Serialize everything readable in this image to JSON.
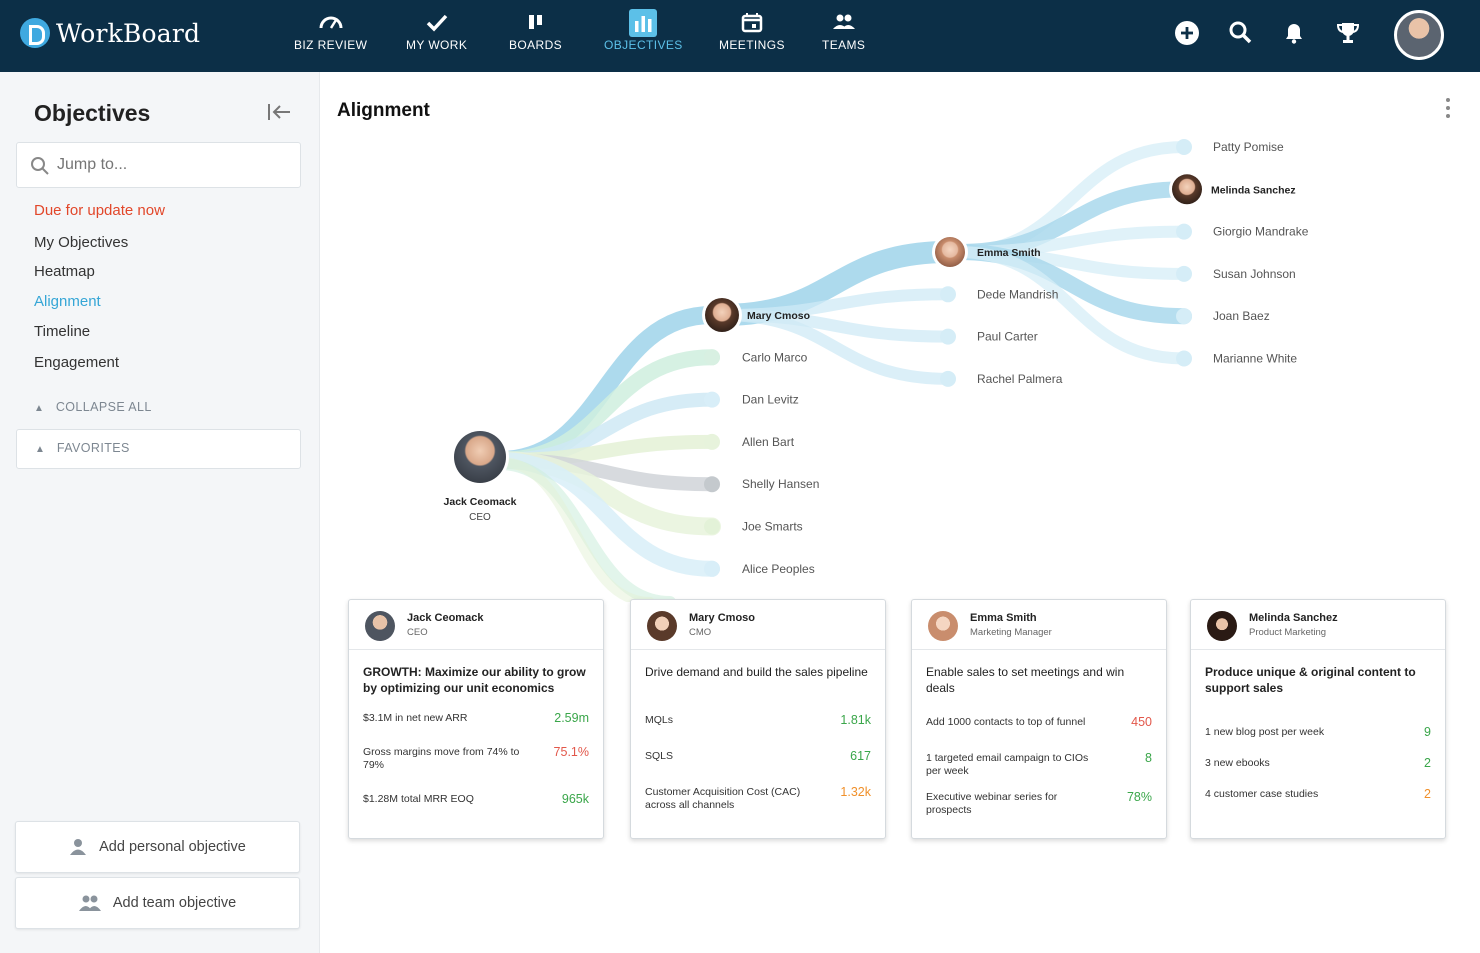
{
  "app": {
    "name": "WorkBoard"
  },
  "nav": [
    {
      "label": "BIZ REVIEW",
      "icon": "gauge-icon"
    },
    {
      "label": "MY WORK",
      "icon": "checkmark-icon"
    },
    {
      "label": "BOARDS",
      "icon": "board-columns-icon"
    },
    {
      "label": "OBJECTIVES",
      "icon": "bar-chart-icon",
      "active": true
    },
    {
      "label": "MEETINGS",
      "icon": "calendar-icon"
    },
    {
      "label": "TEAMS",
      "icon": "team-icon"
    }
  ],
  "topbar_icons": [
    "add-circle-icon",
    "search-icon",
    "bell-icon",
    "trophy-icon",
    "user-avatar"
  ],
  "sidebar": {
    "title": "Objectives",
    "search_placeholder": "Jump to...",
    "due_link": "Due for update now",
    "links": [
      "My Objectives",
      "Heatmap",
      "Alignment",
      "Timeline",
      "Engagement"
    ],
    "active_link": "Alignment",
    "collapse_all": "COLLAPSE ALL",
    "favorites": "FAVORITES",
    "add_personal": "Add personal objective",
    "add_team": "Add team objective"
  },
  "main": {
    "title": "Alignment",
    "tree": {
      "root": {
        "name": "Jack Ceomack",
        "role": "CEO"
      },
      "level1": [
        "Mary Cmoso",
        "Carlo Marco",
        "Dan Levitz",
        "Allen Bart",
        "Shelly Hansen",
        "Joe Smarts",
        "Alice Peoples"
      ],
      "level2": [
        "Emma Smith",
        "Dede Mandrish",
        "Paul Carter",
        "Rachel Palmera"
      ],
      "level3": [
        "Patty Pomise",
        "Melinda Sanchez",
        "Giorgio Mandrake",
        "Susan Johnson",
        "Joan Baez",
        "Marianne White"
      ]
    },
    "cards": [
      {
        "name": "Jack Ceomack",
        "role": "CEO",
        "objective": "GROWTH: Maximize our ability to grow by optimizing our unit economics",
        "krs": [
          {
            "text": "$3.1M in net new ARR",
            "value": "2.59m",
            "status": "green"
          },
          {
            "text": "Gross margins move from 74% to 79%",
            "value": "75.1%",
            "status": "red"
          },
          {
            "text": "$1.28M total MRR EOQ",
            "value": "965k",
            "status": "green"
          }
        ]
      },
      {
        "name": "Mary Cmoso",
        "role": "CMO",
        "objective": "Drive demand and build the sales pipeline",
        "krs": [
          {
            "text": "MQLs",
            "value": "1.81k",
            "status": "green"
          },
          {
            "text": "SQLS",
            "value": "617",
            "status": "green"
          },
          {
            "text": "Customer Acquisition Cost (CAC) across all channels",
            "value": "1.32k",
            "status": "orange"
          }
        ]
      },
      {
        "name": "Emma Smith",
        "role": "Marketing Manager",
        "objective": "Enable sales to set meetings and win deals",
        "krs": [
          {
            "text": "Add 1000 contacts to top of funnel",
            "value": "450",
            "status": "red"
          },
          {
            "text": "1 targeted email campaign to CIOs per week",
            "value": "8",
            "status": "green"
          },
          {
            "text": "Executive webinar series for prospects",
            "value": "78%",
            "status": "green"
          }
        ]
      },
      {
        "name": "Melinda Sanchez",
        "role": "Product Marketing",
        "objective": "Produce unique & original content to support sales",
        "krs": [
          {
            "text": "1 new blog post per week",
            "value": "9",
            "status": "green"
          },
          {
            "text": "3 new ebooks",
            "value": "2",
            "status": "green"
          },
          {
            "text": "4 customer case studies",
            "value": "2",
            "status": "orange"
          }
        ]
      }
    ]
  },
  "colors": {
    "topbar": "#0c2f47",
    "accent": "#35a6d6",
    "due": "#e2472a",
    "good": "#3aa64a",
    "warn": "#f0902a",
    "bad": "#e2574a"
  }
}
